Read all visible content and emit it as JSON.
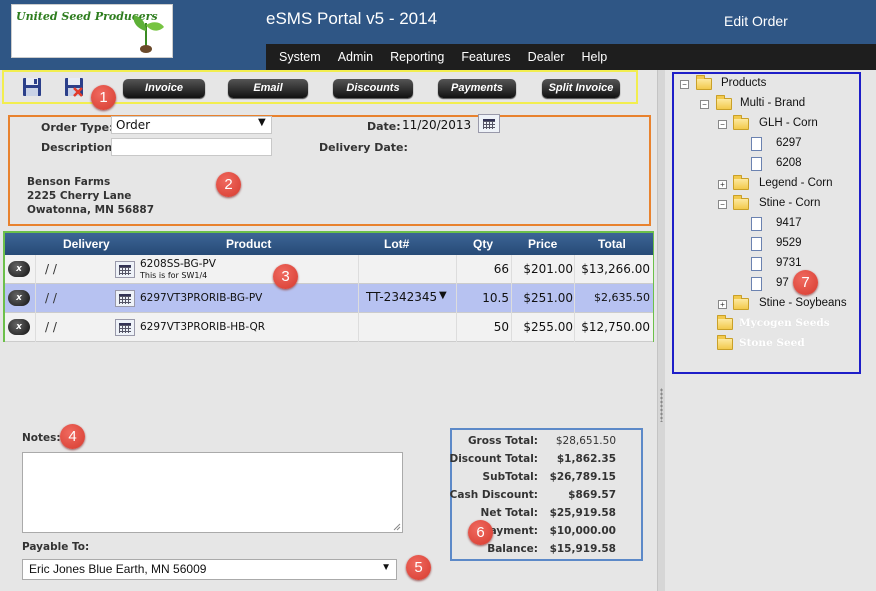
{
  "header": {
    "logo_text": "United Seed Producers",
    "app_title": "eSMS Portal v5 - 2014",
    "page_title": "Edit Order"
  },
  "menu": [
    "System",
    "Admin",
    "Reporting",
    "Features",
    "Dealer",
    "Help"
  ],
  "toolbar": {
    "save_icon": "floppy-disk-icon",
    "cancel_icon": "floppy-delete-icon",
    "buttons": [
      "Invoice",
      "Email",
      "Discounts",
      "Payments",
      "Split Invoice"
    ]
  },
  "order": {
    "order_type_label": "Order Type:",
    "order_type_value": "Order",
    "description_label": "Description:",
    "description_value": "",
    "date_label": "Date:",
    "date_value": "11/20/2013",
    "delivery_date_label": "Delivery Date:",
    "delivery_date_value": "",
    "customer": {
      "name": "Benson Farms",
      "street": "2225 Cherry Lane",
      "city": "Owatonna, MN 56887"
    }
  },
  "grid": {
    "columns": [
      "Delivery",
      "Product",
      "Lot#",
      "Qty",
      "Price",
      "Total"
    ],
    "rows": [
      {
        "delete": "x",
        "delivery": "/ /",
        "product": "6208SS-BG-PV",
        "note": "This is for SW1/4",
        "lot": "",
        "qty": "66",
        "price": "$201.00",
        "total": "$13,266.00"
      },
      {
        "delete": "x",
        "delivery": "/ /",
        "product": "6297VT3PRORIB-BG-PV",
        "note": "",
        "lot": "TT-2342345",
        "qty": "10.5",
        "price": "$251.00",
        "total": "$2,635.50"
      },
      {
        "delete": "x",
        "delivery": "/ /",
        "product": "6297VT3PRORIB-HB-QR",
        "note": "",
        "lot": "",
        "qty": "50",
        "price": "$255.00",
        "total": "$12,750.00"
      }
    ]
  },
  "notes": {
    "label": "Notes:",
    "value": ""
  },
  "payable": {
    "label": "Payable To:",
    "value": "Eric Jones Blue Earth, MN 56009"
  },
  "totals": [
    {
      "label": "Gross Total:",
      "value": "$28,651.50"
    },
    {
      "label": "Discount Total:",
      "value": "$1,862.35"
    },
    {
      "label": "SubTotal:",
      "value": "$26,789.15"
    },
    {
      "label": "Cash Discount:",
      "value": "$869.57"
    },
    {
      "label": "Net Total:",
      "value": "$25,919.58"
    },
    {
      "label": "Payment:",
      "value": "$10,000.00"
    },
    {
      "label": "Balance:",
      "value": "$15,919.58"
    }
  ],
  "tree": [
    {
      "label": "Products",
      "type": "folder",
      "exp": "−"
    },
    {
      "label": "Multi - Brand",
      "type": "folder",
      "exp": "−"
    },
    {
      "label": "GLH - Corn",
      "type": "folder",
      "exp": "−"
    },
    {
      "label": "6297",
      "type": "doc"
    },
    {
      "label": "6208",
      "type": "doc"
    },
    {
      "label": "Legend - Corn",
      "type": "folder",
      "exp": "+"
    },
    {
      "label": "Stine - Corn",
      "type": "folder",
      "exp": "−"
    },
    {
      "label": "9417",
      "type": "doc"
    },
    {
      "label": "9529",
      "type": "doc"
    },
    {
      "label": "9731",
      "type": "doc"
    },
    {
      "label": "97",
      "type": "doc"
    },
    {
      "label": "Stine - Soybeans",
      "type": "folder",
      "exp": "+"
    },
    {
      "label": "Mycogen Seeds",
      "type": "folder"
    },
    {
      "label": "Stone Seed",
      "type": "folder"
    }
  ],
  "badges": [
    "1",
    "2",
    "3",
    "4",
    "5",
    "6",
    "7"
  ],
  "colors": {
    "header_bg": "#2f5685",
    "menubar_bg": "#1e1e1e",
    "toolbar_frame": "#f2ee4f",
    "form_frame": "#e8822e",
    "grid_frame": "#6cc04a",
    "totals_frame": "#5c89c8",
    "tree_frame": "#1e1ec8",
    "badge": "#e04b40",
    "selected_row": "#b7c2f1"
  }
}
